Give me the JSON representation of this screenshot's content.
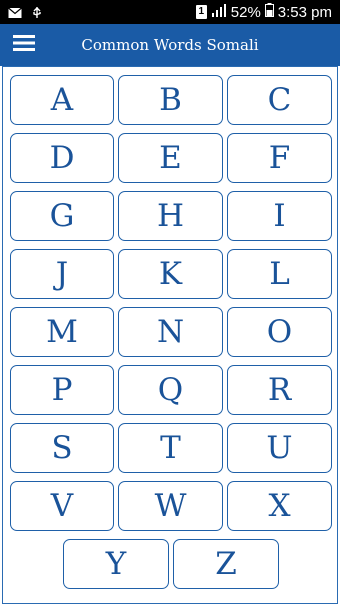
{
  "status_bar": {
    "sim_label": "1",
    "battery": "52%",
    "time": "3:53 pm"
  },
  "app_bar": {
    "title": "Common Words Somali",
    "menu_icon": "hamburger-menu-icon"
  },
  "letters": [
    "A",
    "B",
    "C",
    "D",
    "E",
    "F",
    "G",
    "H",
    "I",
    "J",
    "K",
    "L",
    "M",
    "N",
    "O",
    "P",
    "Q",
    "R",
    "S",
    "T",
    "U",
    "V",
    "W",
    "X",
    "Y",
    "Z"
  ],
  "colors": {
    "app_bar": "#1a5ba6",
    "letter_text": "#1a5399",
    "button_border": "#1f60a8"
  }
}
